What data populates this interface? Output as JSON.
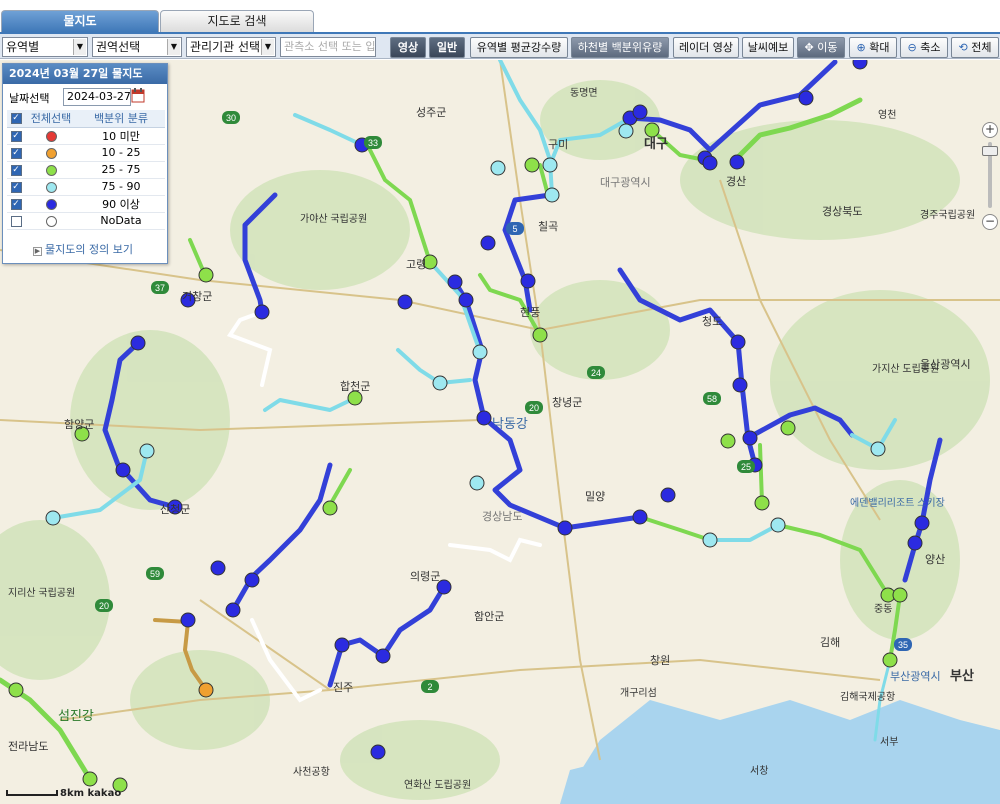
{
  "tabs": {
    "active": "물지도",
    "inactive": "지도로 검색"
  },
  "toolbar": {
    "select_watershed": "유역별",
    "select_region": "권역선택",
    "select_agency": "관리기관 선택",
    "station_input_placeholder": "관측소 선택 또는 입",
    "btn_image": "영상",
    "btn_normal": "일반",
    "btn_rainfall": "유역별 평균강수량",
    "btn_river": "하천별 백분위유량",
    "btn_radar": "레이더 영상",
    "btn_weather": "날씨예보",
    "btn_move": "이동",
    "btn_zoom_in": "확대",
    "btn_zoom_out": "축소",
    "btn_all": "전체"
  },
  "panel": {
    "title": "2024년 03월 27일 물지도",
    "date_label": "날짜선택",
    "date_value": "2024-03-27",
    "col_select_all": "전체선택",
    "col_percentile": "백분위 분류",
    "definition_link": "물지도의 정의 보기",
    "rows": [
      {
        "label": "10 미만",
        "color": "#e53935",
        "checked": true
      },
      {
        "label": "10 - 25",
        "color": "#f0a030",
        "checked": true
      },
      {
        "label": "25 - 75",
        "color": "#8ee04a",
        "checked": true
      },
      {
        "label": "75 - 90",
        "color": "#9ee8f0",
        "checked": true
      },
      {
        "label": "90 이상",
        "color": "#2b2be0",
        "checked": true
      },
      {
        "label": "NoData",
        "color": "#ffffff",
        "checked": false
      }
    ]
  },
  "map": {
    "place_labels": [
      "성주군",
      "구미",
      "대구",
      "경산",
      "경상북도",
      "경주국립공원",
      "가야산 국립공원",
      "고령",
      "현풍",
      "창녕군",
      "청도",
      "가지산 도립공원",
      "울산광역시",
      "합천군",
      "함양군",
      "의령군",
      "함안군",
      "창원",
      "김해",
      "부산",
      "양산",
      "산청군",
      "진주",
      "사천공항",
      "연화산 도립공원",
      "지리산 국립공원",
      "섬진강",
      "전라남도",
      "에덴밸리리조트 스키장",
      "부산광역시",
      "김해국제공항",
      "밀양",
      "거창군",
      "영천",
      "대구광역시",
      "경상남도",
      "낙동강",
      "동명면",
      "칠곡",
      "서부",
      "중동",
      "서창",
      "개구리섬"
    ],
    "road_labels": [
      "30",
      "37",
      "5",
      "24",
      "20",
      "58",
      "35",
      "59",
      "20",
      "2",
      "25",
      "33"
    ],
    "scale_label": "8km",
    "attribution": "kakao"
  }
}
